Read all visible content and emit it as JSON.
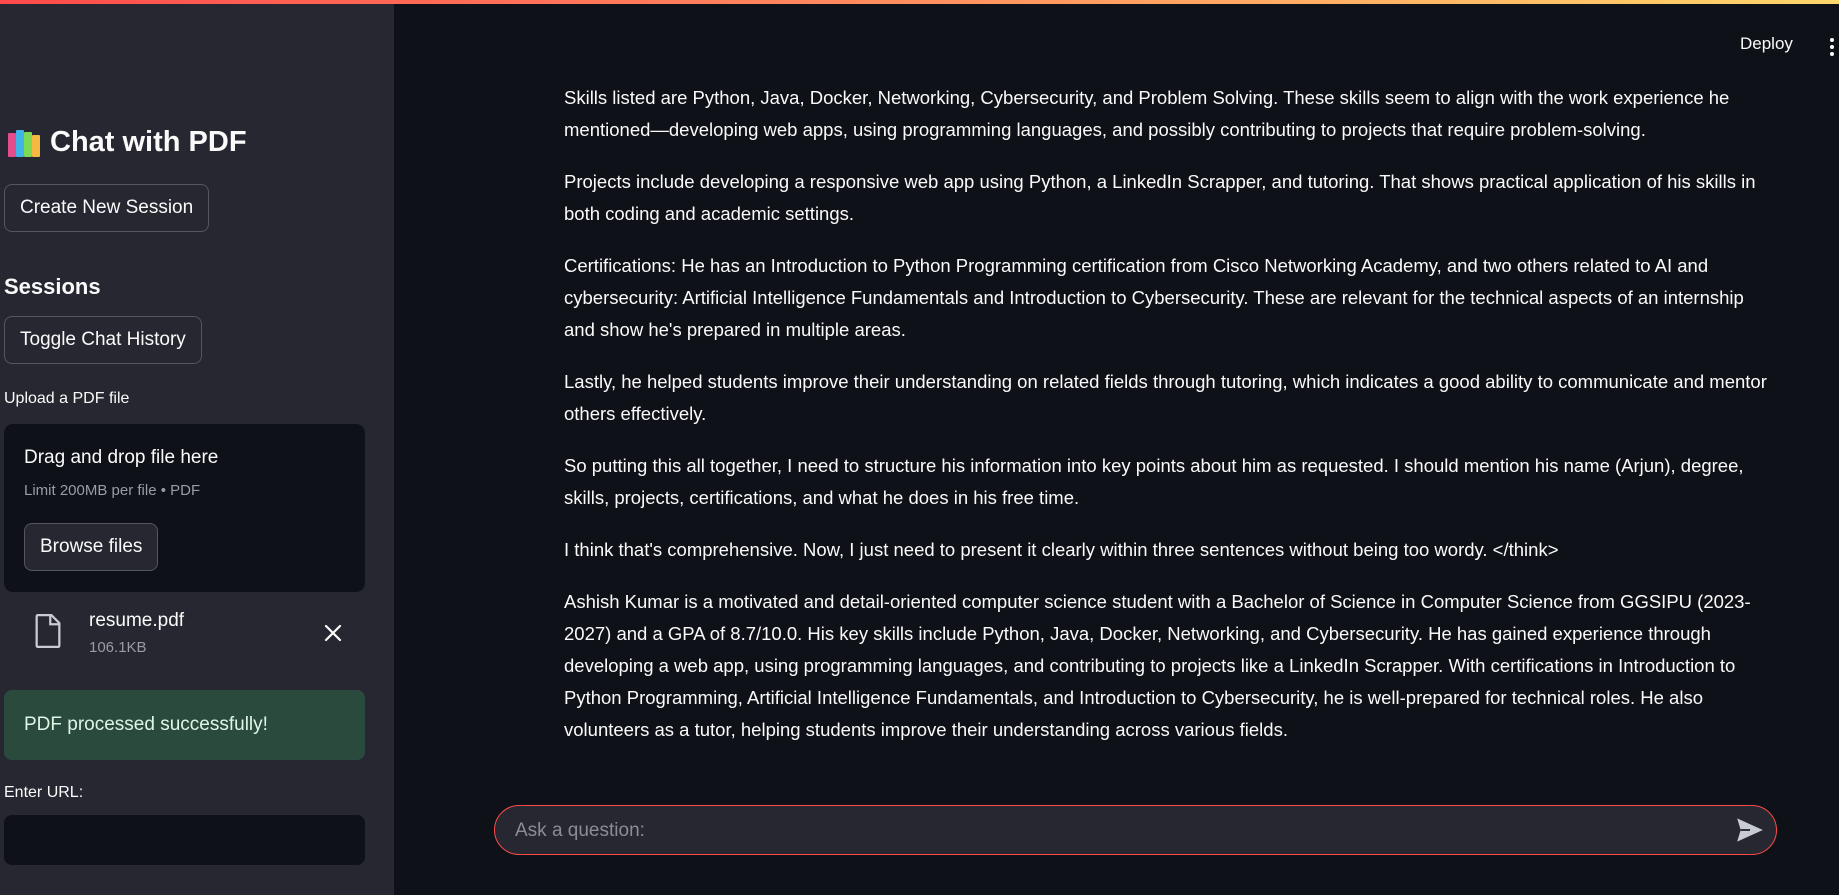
{
  "app": {
    "title": "Chat with PDF",
    "title_icon": "books-icon",
    "accent_color": "#ff4b4b"
  },
  "header": {
    "deploy_label": "Deploy",
    "menu_icon": "kebab-menu-icon"
  },
  "sidebar": {
    "create_session_label": "Create New Session",
    "sessions_heading": "Sessions",
    "toggle_history_label": "Toggle Chat History",
    "upload": {
      "label": "Upload a PDF file",
      "drop_title": "Drag and drop file here",
      "limit_text": "Limit 200MB per file • PDF",
      "browse_label": "Browse files",
      "file": {
        "name": "resume.pdf",
        "size": "106.1KB",
        "icon": "file-icon",
        "remove_icon": "close-icon"
      }
    },
    "success_message": "PDF processed successfully!",
    "url": {
      "label": "Enter URL:",
      "value": ""
    }
  },
  "chat": {
    "paragraphs": [
      "Skills listed are Python, Java, Docker, Networking, Cybersecurity, and Problem Solving. These skills seem to align with the work experience he mentioned—developing web apps, using programming languages, and possibly contributing to projects that require problem-solving.",
      "Projects include developing a responsive web app using Python, a LinkedIn Scrapper, and tutoring. That shows practical application of his skills in both coding and academic settings.",
      "Certifications: He has an Introduction to Python Programming certification from Cisco Networking Academy, and two others related to AI and cybersecurity: Artificial Intelligence Fundamentals and Introduction to Cybersecurity. These are relevant for the technical aspects of an internship and show he's prepared in multiple areas.",
      "Lastly, he helped students improve their understanding on related fields through tutoring, which indicates a good ability to communicate and mentor others effectively.",
      "So putting this all together, I need to structure his information into key points about him as requested. I should mention his name (Arjun), degree, skills, projects, certifications, and what he does in his free time.",
      "I think that's comprehensive. Now, I just need to present it clearly within three sentences without being too wordy. </think>",
      "Ashish Kumar is a motivated and detail-oriented computer science student with a Bachelor of Science in Computer Science from GGSIPU (2023-2027) and a GPA of 8.7/10.0. His key skills include Python, Java, Docker, Networking, and Cybersecurity. He has gained experience through developing a web app, using programming languages, and contributing to projects like a LinkedIn Scrapper. With certifications in Introduction to Python Programming, Artificial Intelligence Fundamentals, and Introduction to Cybersecurity, he is well-prepared for technical roles. He also volunteers as a tutor, helping students improve their understanding across various fields."
    ],
    "input": {
      "placeholder": "Ask a question:",
      "value": "",
      "send_icon": "send-icon"
    }
  }
}
